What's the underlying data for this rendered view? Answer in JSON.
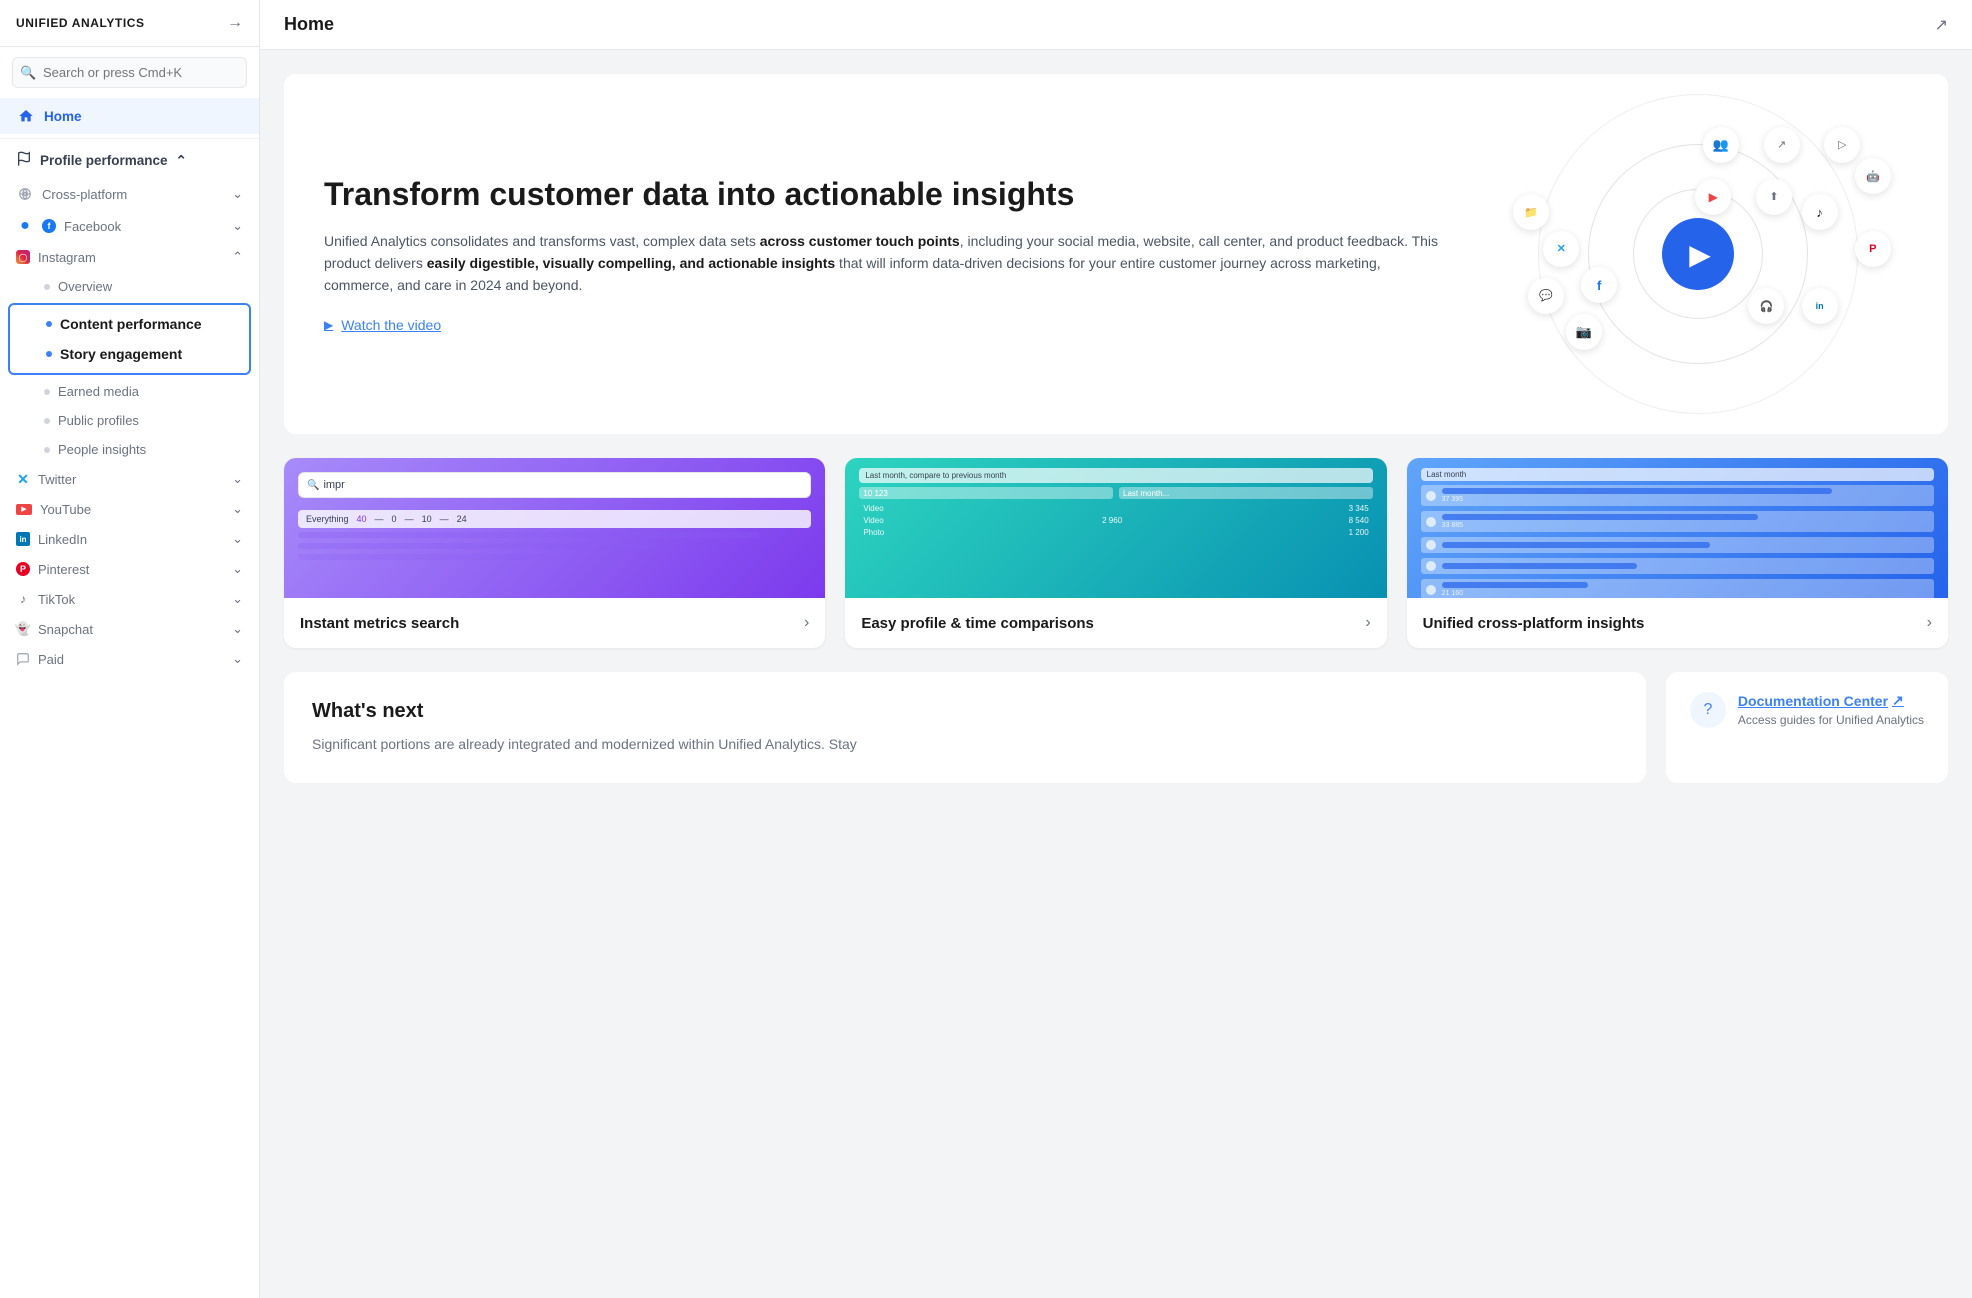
{
  "app": {
    "title": "UNIFIED ANALYTICS",
    "page_title": "Home"
  },
  "sidebar": {
    "search_placeholder": "Search or press Cmd+K",
    "home_label": "Home",
    "sections": {
      "profile_performance": "Profile performance",
      "cross_platform": "Cross-platform",
      "facebook": "Facebook",
      "instagram": "Instagram",
      "overview": "Overview",
      "content_performance": "Content performance",
      "story_engagement": "Story engagement",
      "earned_media": "Earned media",
      "public_profiles": "Public profiles",
      "people_insights": "People insights",
      "twitter": "Twitter",
      "youtube": "YouTube",
      "linkedin": "LinkedIn",
      "pinterest": "Pinterest",
      "tiktok": "TikTok",
      "snapchat": "Snapchat",
      "paid": "Paid"
    }
  },
  "hero": {
    "title": "Transform customer data into actionable insights",
    "description_plain": "Unified Analytics consolidates and transforms vast, complex data sets ",
    "description_bold1": "across customer touch points",
    "description_mid": ", including your social media, website, call center, and product feedback. This product delivers ",
    "description_bold2": "easily digestible, visually compelling, and actionable insights",
    "description_end": " that will inform data-driven decisions for your entire customer journey across marketing, commerce, and care in 2024 and beyond.",
    "watch_label": "Watch the video"
  },
  "cards": [
    {
      "title": "Instant metrics search",
      "color": "purple"
    },
    {
      "title": "Easy profile & time comparisons",
      "color": "teal"
    },
    {
      "title": "Unified cross-platform insights",
      "color": "blue"
    }
  ],
  "whats_next": {
    "title": "What's next",
    "description": "Significant portions are already integrated and modernized within Unified Analytics. Stay"
  },
  "docs": {
    "link": "Documentation Center",
    "sub": "Access guides for Unified Analytics"
  }
}
